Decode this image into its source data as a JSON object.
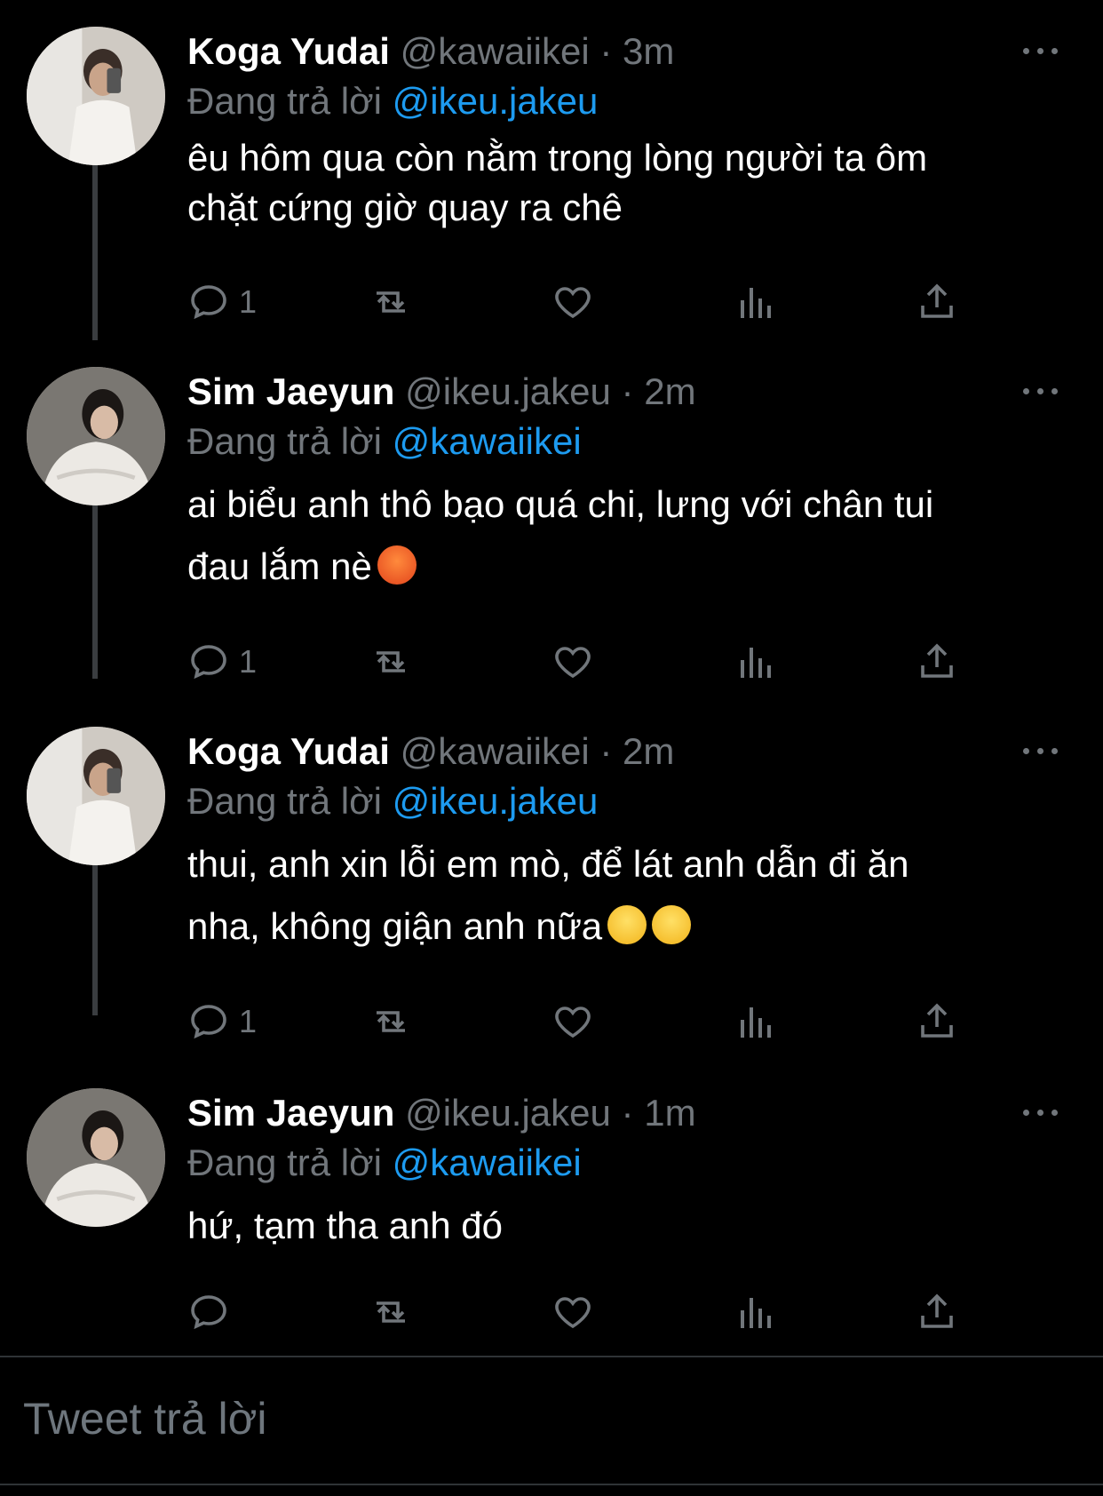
{
  "tweets": [
    {
      "name": "Koga Yudai",
      "handle": "@kawaiikei",
      "time": "3m",
      "replying_prefix": "Đang trả lời",
      "replying_to": "@ikeu.jakeu",
      "text": "êu hôm qua còn nằm trong lòng người ta ôm\nchặt cứng giờ quay ra chê",
      "emojis": [],
      "reply_count": "1"
    },
    {
      "name": "Sim Jaeyun",
      "handle": "@ikeu.jakeu",
      "time": "2m",
      "replying_prefix": "Đang trả lời",
      "replying_to": "@kawaiikei",
      "text": "ai biểu anh thô bạo quá chi, lưng với chân tui\nđau lắm nè",
      "emojis": [
        "angry-face-emoji"
      ],
      "reply_count": "1"
    },
    {
      "name": "Koga Yudai",
      "handle": "@kawaiikei",
      "time": "2m",
      "replying_prefix": "Đang trả lời",
      "replying_to": "@ikeu.jakeu",
      "text": "thui, anh xin lỗi em mò, để lát anh dẫn đi ăn\nnha, không giận anh nữa",
      "emojis": [
        "kissing-face-emoji",
        "kissing-face-emoji"
      ],
      "reply_count": "1"
    },
    {
      "name": "Sim Jaeyun",
      "handle": "@ikeu.jakeu",
      "time": "1m",
      "replying_prefix": "Đang trả lời",
      "replying_to": "@kawaiikei",
      "text": "hứ, tạm tha anh đó",
      "emojis": [],
      "reply_count": ""
    }
  ],
  "composer": {
    "placeholder": "Tweet trả lời"
  },
  "colors": {
    "background": "#000000",
    "accent": "#1d9bf0",
    "muted": "#71767b",
    "text": "#ffffff"
  },
  "icons": [
    "reply-icon",
    "retweet-icon",
    "like-icon",
    "analytics-icon",
    "share-icon",
    "more-icon"
  ]
}
